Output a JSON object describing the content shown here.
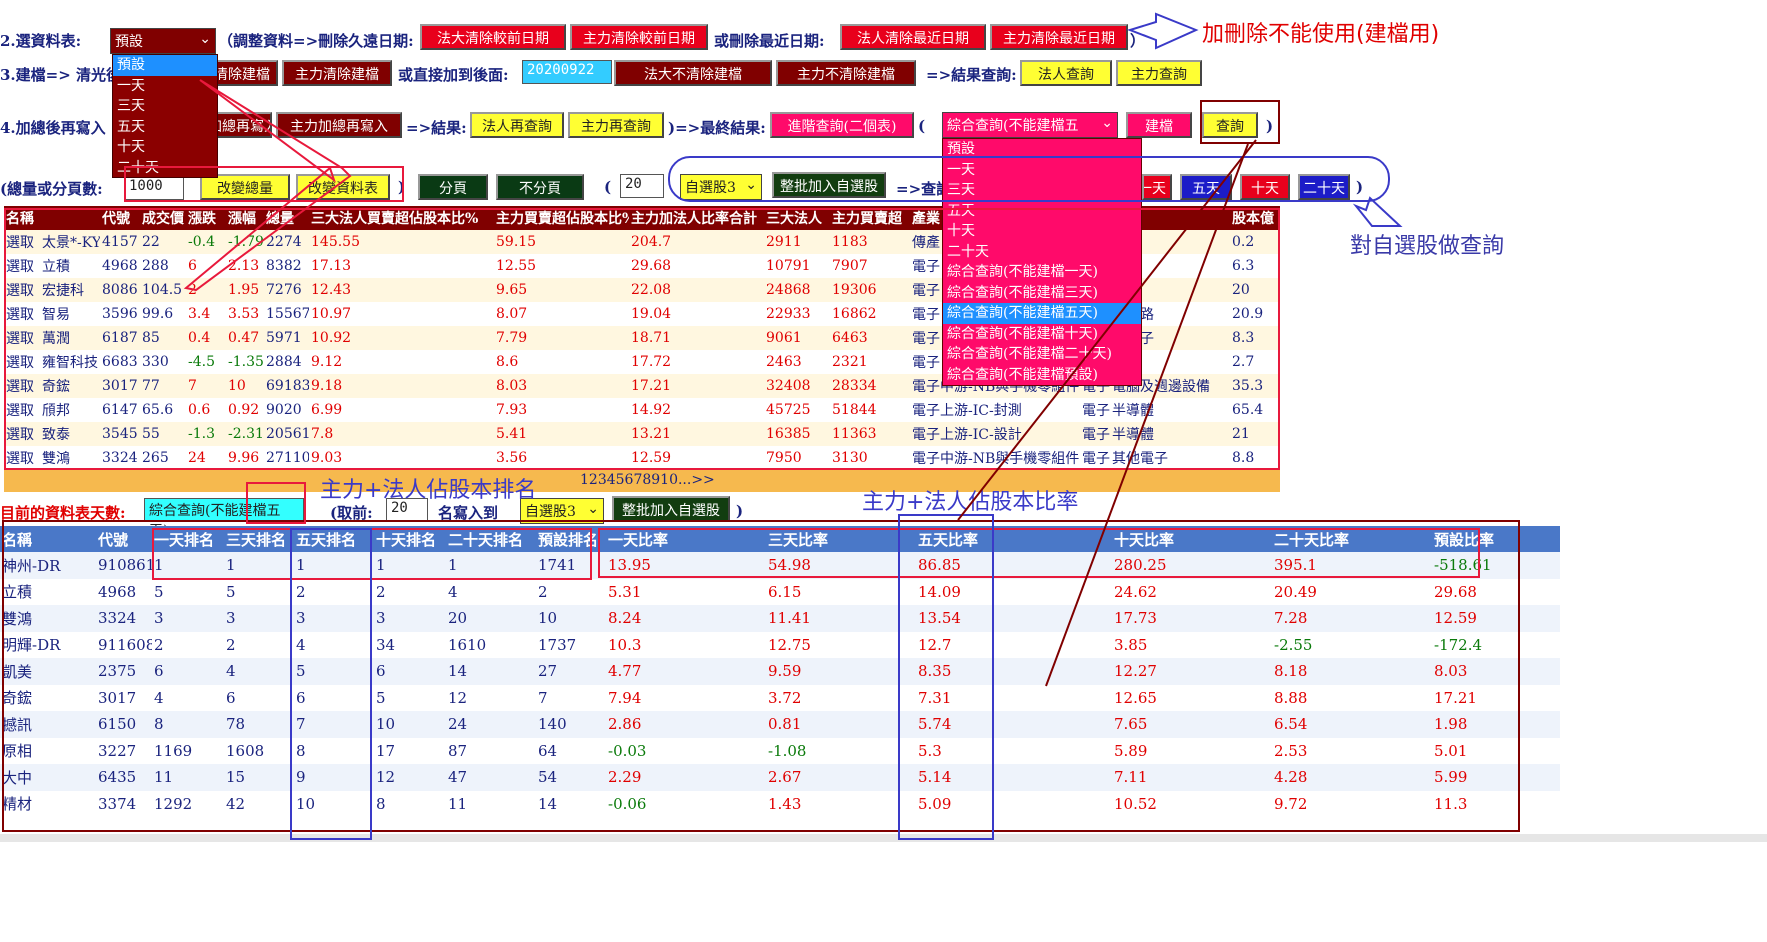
{
  "row2": {
    "label": "2.選資料表:",
    "select_value": "預設",
    "text1": "（調整資料=>刪除久遠日期:",
    "btn1": "法大清除較前日期",
    "btn2": "主力清除較前日期",
    "text2": "或刪除最近日期:",
    "btn3": "法人清除最近日期",
    "btn4": "主力清除最近日期",
    "text3": "）",
    "annotation": "加刪除不能使用(建檔用)"
  },
  "row3": {
    "label": "3.建檔=> 清光後",
    "btn1": "法人清除建檔",
    "btn2": "主力清除建檔",
    "text1": "或直接加到後面:",
    "date_value": "20200922",
    "btn3": "法大不清除建檔",
    "btn4": "主力不清除建檔",
    "text2": "=>結果查詢:",
    "btn5": "法人查詢",
    "btn6": "主力查詢"
  },
  "row4": {
    "label": "4.加總後再寫入",
    "btn1": "法人加總再寫入",
    "btn2": "主力加總再寫入",
    "text1": "=>結果:",
    "btn3": "法人再查詢",
    "btn4": "主力再查詢",
    "text2": ")=>最終結果:",
    "btn5": "進階查詢(二個表)",
    "paren_open": "(",
    "select_value": "綜合查詢(不能建檔五",
    "btn6": "建檔",
    "btn7": "查詢",
    "paren_close": ")"
  },
  "row5": {
    "label": "(總量或分頁數:",
    "total_value": "1000",
    "btn1": "改變總量",
    "btn2": "改變資料表",
    "paren_close": ")",
    "btn3": "分頁",
    "btn4": "不分頁",
    "paren_open": "(",
    "page_value": "20",
    "group_select": "自選股3",
    "btn5": "整批加入自選股",
    "text1": "=>查詢",
    "btn_day1": "一天",
    "btn_day5": "五天",
    "btn_day10": "十天",
    "btn_day20": "二十天",
    "paren_close2": ")",
    "annotation": "對自選股做查詢"
  },
  "dropdown1": {
    "options": [
      "預設",
      "一天",
      "三天",
      "五天",
      "十天",
      "二十天"
    ]
  },
  "dropdown2": {
    "options": [
      "預設",
      "一天",
      "三天",
      "五天",
      "十天",
      "二十天",
      "綜合查詢(不能建檔一天)",
      "綜合查詢(不能建檔三天)",
      "綜合查詢(不能建檔五天)",
      "綜合查詢(不能建檔十天)",
      "綜合查詢(不能建檔二十天)",
      "綜合查詢(不能建檔預設)"
    ],
    "selected_index": 8
  },
  "table1": {
    "headers": [
      "名稱",
      "代號",
      "成交價",
      "漲跌",
      "漲幅",
      "總量",
      "三大法人買賣超佔股本比%",
      "主力買賣超佔股本比%",
      "主力加法人比率合計",
      "三大法人",
      "主力買賣超",
      "產業",
      "",
      "類",
      "股本億"
    ],
    "rows": [
      [
        "選取",
        "太景*-KY",
        "4157",
        "22",
        "-0.4",
        "-1.79",
        "2274",
        "145.55",
        "59.15",
        "204.7",
        "2911",
        "1183",
        "傳產",
        "",
        "",
        "0.2"
      ],
      [
        "選取",
        "立積",
        "4968",
        "288",
        "6",
        "2.13",
        "8382",
        "17.13",
        "12.55",
        "29.68",
        "10791",
        "7907",
        "電子",
        "",
        "導體",
        "6.3"
      ],
      [
        "選取",
        "宏捷科",
        "8086",
        "104.5",
        "2",
        "1.95",
        "7276",
        "12.43",
        "9.65",
        "22.08",
        "24868",
        "19306",
        "電子",
        "",
        "導體",
        "20"
      ],
      [
        "選取",
        "智易",
        "3596",
        "99.6",
        "3.4",
        "3.53",
        "15567",
        "10.97",
        "8.07",
        "19.04",
        "22933",
        "16862",
        "電子",
        "",
        "信網路",
        "20.9"
      ],
      [
        "選取",
        "萬潤",
        "6187",
        "85",
        "0.4",
        "0.47",
        "5971",
        "10.92",
        "7.79",
        "18.71",
        "9061",
        "6463",
        "電子",
        "",
        "他電子",
        "8.3"
      ],
      [
        "選取",
        "雍智科技",
        "6683",
        "330",
        "-4.5",
        "-1.35",
        "2884",
        "9.12",
        "8.6",
        "17.72",
        "2463",
        "2321",
        "電子",
        "",
        "導體",
        "2.7"
      ],
      [
        "選取",
        "奇鋐",
        "3017",
        "77",
        "7",
        "10",
        "69183",
        "9.18",
        "8.03",
        "17.21",
        "32408",
        "28334",
        "電子中游-NB與手機零組件",
        "電子",
        "電腦及週邊設備",
        "35.3"
      ],
      [
        "選取",
        "頎邦",
        "6147",
        "65.6",
        "0.6",
        "0.92",
        "9020",
        "6.99",
        "7.93",
        "14.92",
        "45725",
        "51844",
        "電子上游-IC-封測",
        "電子",
        "半導體",
        "65.4"
      ],
      [
        "選取",
        "致泰",
        "3545",
        "55",
        "-1.3",
        "-2.31",
        "20561",
        "7.8",
        "5.41",
        "13.21",
        "16385",
        "11363",
        "電子上游-IC-設計",
        "電子",
        "半導體",
        "21"
      ],
      [
        "選取",
        "雙鴻",
        "3324",
        "265",
        "24",
        "9.96",
        "27110",
        "9.03",
        "3.56",
        "12.59",
        "7950",
        "3130",
        "電子中游-NB與手機零組件",
        "電子",
        "其他電子",
        "8.8"
      ]
    ]
  },
  "pager": {
    "text": "12345678910...>>"
  },
  "annot_rank": "主力+法人佔股本排名",
  "annot_ratio": "主力+法人佔股本比率",
  "row_current": {
    "label": "目前的資料表天數:",
    "current_value": "綜合查詢(不能建檔五天)",
    "text1": "(取前:",
    "top_value": "20",
    "text2": "名寫入到",
    "group_select": "自選股3",
    "btn1": "整批加入自選股",
    "paren_close": ")"
  },
  "table2": {
    "headers": [
      "名稱",
      "代號",
      "一天排名",
      "三天排名",
      "五天排名",
      "十天排名",
      "二十天排名",
      "預設排名",
      "一天比率",
      "三天比率",
      "五天比率",
      "十天比率",
      "二十天比率",
      "預設比率"
    ],
    "rows": [
      [
        "神州-DR",
        "910861",
        "1",
        "1",
        "1",
        "1",
        "1",
        "1741",
        "13.95",
        "54.98",
        "86.85",
        "280.25",
        "395.1",
        "-518.61"
      ],
      [
        "立積",
        "4968",
        "5",
        "5",
        "2",
        "2",
        "4",
        "2",
        "5.31",
        "6.15",
        "14.09",
        "24.62",
        "20.49",
        "29.68"
      ],
      [
        "雙鴻",
        "3324",
        "3",
        "3",
        "3",
        "3",
        "20",
        "10",
        "8.24",
        "11.41",
        "13.54",
        "17.73",
        "7.28",
        "12.59"
      ],
      [
        "明輝-DR",
        "911608",
        "2",
        "2",
        "4",
        "34",
        "1610",
        "1737",
        "10.3",
        "12.75",
        "12.7",
        "3.85",
        "-2.55",
        "-172.4"
      ],
      [
        "凱美",
        "2375",
        "6",
        "4",
        "5",
        "6",
        "14",
        "27",
        "4.77",
        "9.59",
        "8.35",
        "12.27",
        "8.18",
        "8.03"
      ],
      [
        "奇鋐",
        "3017",
        "4",
        "6",
        "6",
        "5",
        "12",
        "7",
        "7.94",
        "3.72",
        "7.31",
        "12.65",
        "8.88",
        "17.21"
      ],
      [
        "撼訊",
        "6150",
        "8",
        "78",
        "7",
        "10",
        "24",
        "140",
        "2.86",
        "0.81",
        "5.74",
        "7.65",
        "6.54",
        "1.98"
      ],
      [
        "原相",
        "3227",
        "1169",
        "1608",
        "8",
        "17",
        "87",
        "64",
        "-0.03",
        "-1.08",
        "5.3",
        "5.89",
        "2.53",
        "5.01"
      ],
      [
        "大中",
        "6435",
        "11",
        "15",
        "9",
        "12",
        "47",
        "54",
        "2.29",
        "2.67",
        "5.14",
        "7.11",
        "4.28",
        "5.99"
      ],
      [
        "精材",
        "3374",
        "1292",
        "42",
        "10",
        "8",
        "11",
        "14",
        "-0.06",
        "1.43",
        "5.09",
        "10.52",
        "9.72",
        "11.3"
      ]
    ]
  },
  "colors": {
    "accent_red": "#e8001c",
    "accent_yellow": "#ffff33",
    "accent_pink": "#ff0a6a",
    "accent_blue": "#1c1cc8",
    "header_dark": "#800000",
    "header_blue": "#4a78c8",
    "band_orange": "#f6b94e"
  }
}
